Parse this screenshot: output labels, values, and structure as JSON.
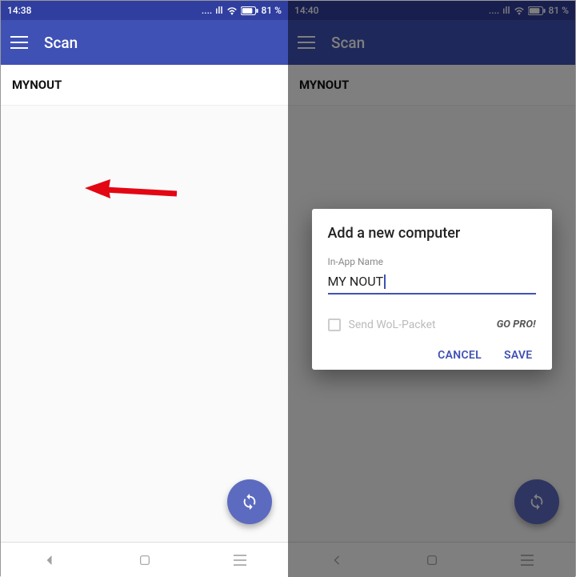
{
  "left": {
    "status": {
      "time": "14:38",
      "battery": "81 %"
    },
    "toolbar": {
      "title": "Scan"
    },
    "list": {
      "item0": "MYNOUT"
    }
  },
  "right": {
    "status": {
      "time": "14:40",
      "battery": "81 %"
    },
    "toolbar": {
      "title": "Scan"
    },
    "list": {
      "item0": "MYNOUT"
    },
    "dialog": {
      "title": "Add a new computer",
      "field_label": "In-App Name",
      "field_value": "MY NOUT",
      "wol_label": "Send WoL-Packet",
      "gopro": "GO PRO!",
      "cancel": "CANCEL",
      "save": "SAVE"
    }
  },
  "icons": {
    "signal_dots": "....",
    "bars": "ıll"
  }
}
